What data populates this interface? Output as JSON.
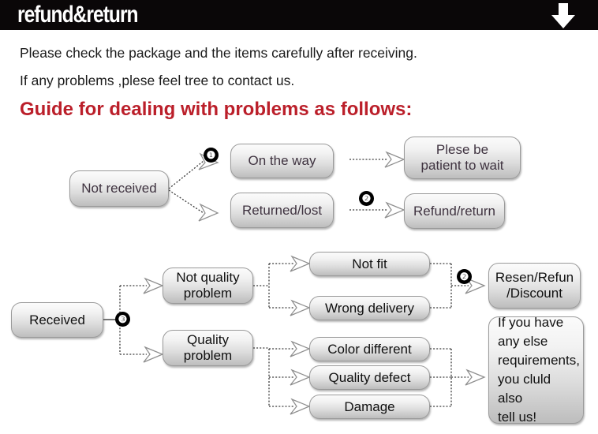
{
  "header": {
    "title": "refund&return",
    "arrow_icon": "arrow-down-icon"
  },
  "intro": {
    "line1": "Please check the package and the items carefully after receiving.",
    "line2": "If any problems ,plese feel tree to contact us.",
    "guide_heading": "Guide for dealing with problems as follows:",
    "heading_color": "#bb1f2a"
  },
  "flow_top": {
    "badges": [
      "❶",
      "❷"
    ],
    "nodes": {
      "not_received": "Not received",
      "on_the_way": "On the way",
      "returned_lost": "Returned/lost",
      "please_wait": "Plese be\npatient to wait",
      "refund_return": "Refund/return"
    }
  },
  "flow_bottom": {
    "badges": [
      "❸",
      "❷"
    ],
    "nodes": {
      "received": "Received",
      "not_quality_problem": "Not quality\nproblem",
      "quality_problem": "Quality\nproblem",
      "not_fit": "Not fit",
      "wrong_delivery": "Wrong delivery",
      "color_different": "Color different",
      "quality_defect": "Quality defect",
      "damage": "Damage",
      "resend_refund_discount": "Resen/Refun\n/Discount",
      "any_else": "If you have\nany else\nrequirements,\nyou cluld also\ntell us!"
    }
  },
  "colors": {
    "banner_bg": "#0a0708",
    "banner_text": "#ffffff",
    "body_text": "#1b1b1b",
    "accent_red": "#bb1f2a",
    "node_text_top": "#3f3340",
    "node_text_bottom": "#101010"
  }
}
